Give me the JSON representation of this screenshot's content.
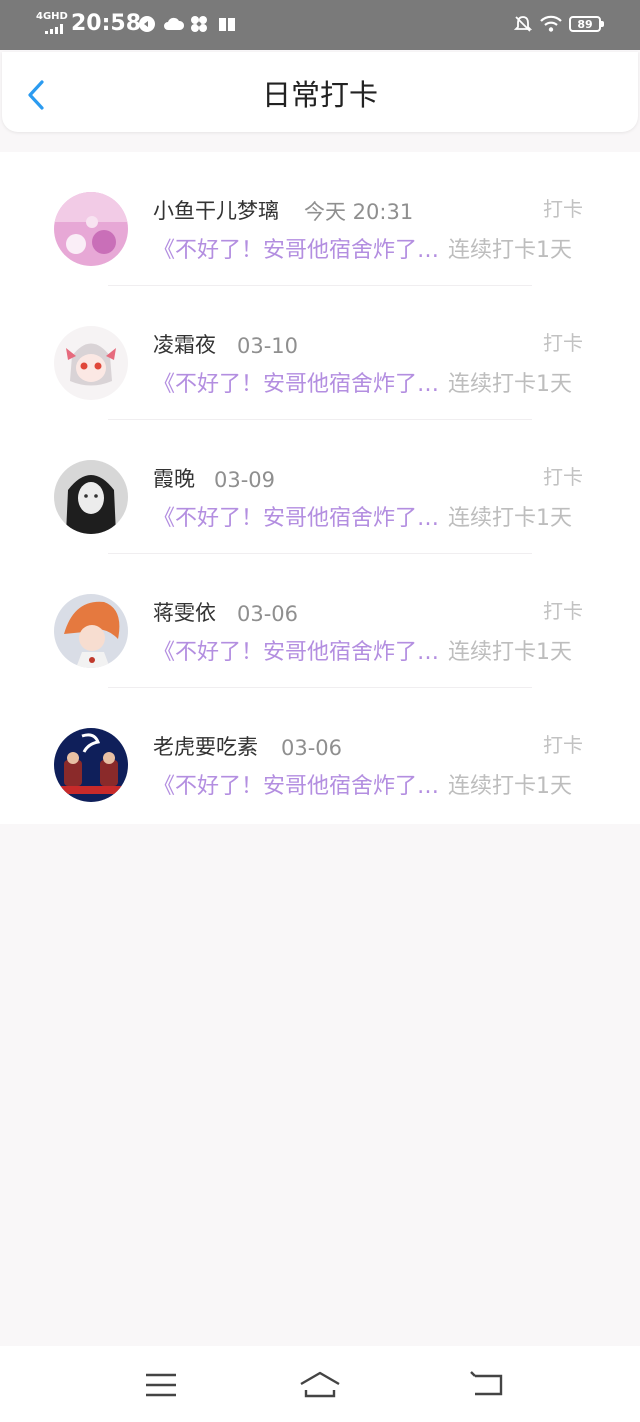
{
  "status_bar": {
    "network": "4GHD",
    "time": "20:58",
    "battery": "89"
  },
  "header": {
    "title": "日常打卡"
  },
  "list": [
    {
      "name": "小鱼干儿梦璃",
      "time": "今天 20:31",
      "action": "打卡",
      "message": "《不好了！安哥他宿舍炸了…",
      "streak": "连续打卡1天"
    },
    {
      "name": "凌霜夜",
      "time": "03-10",
      "action": "打卡",
      "message": "《不好了！安哥他宿舍炸了…",
      "streak": "连续打卡1天"
    },
    {
      "name": "霞晚",
      "time": "03-09",
      "action": "打卡",
      "message": "《不好了！安哥他宿舍炸了…",
      "streak": "连续打卡1天"
    },
    {
      "name": "蒋雯依",
      "time": "03-06",
      "action": "打卡",
      "message": "《不好了！安哥他宿舍炸了…",
      "streak": "连续打卡1天"
    },
    {
      "name": "老虎要吃素",
      "time": "03-06",
      "action": "打卡",
      "message": "《不好了！安哥他宿舍炸了…",
      "streak": "连续打卡1天"
    }
  ],
  "colors": {
    "accent": "#2b9bf0",
    "message": "#b38ee0",
    "muted": "#bdbdbd"
  }
}
